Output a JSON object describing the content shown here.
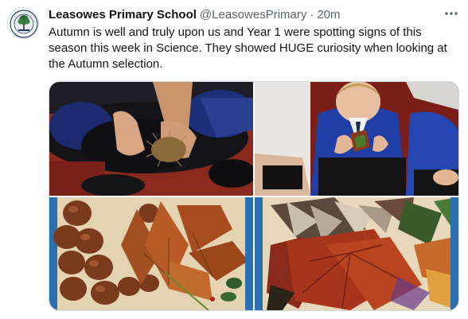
{
  "tweet": {
    "display_name": "Leasowes Primary School",
    "handle": "@LeasowesPrimary",
    "separator": "·",
    "timestamp": "20m",
    "text": "Autumn is well and truly upon us and Year 1 were spotting signs of this season this week in Science. They showed HUGE curiosity when looking at the Autumn selection.",
    "avatar_icon": "school-crest-icon",
    "more_icon": "more-options-icon"
  },
  "media": {
    "photo_count": 4,
    "photos": [
      {
        "subject": "child holding spiky conker case"
      },
      {
        "subject": "boy in blue jumper holding leaf"
      },
      {
        "subject": "conkers and brown leaves"
      },
      {
        "subject": "autumn leaves collection"
      }
    ]
  },
  "colors": {
    "text_primary": "#0f1419",
    "text_secondary": "#536471",
    "border": "#cfd9de",
    "uniform_blue": "#1f3fa6",
    "carpet_red": "#7a2018"
  }
}
